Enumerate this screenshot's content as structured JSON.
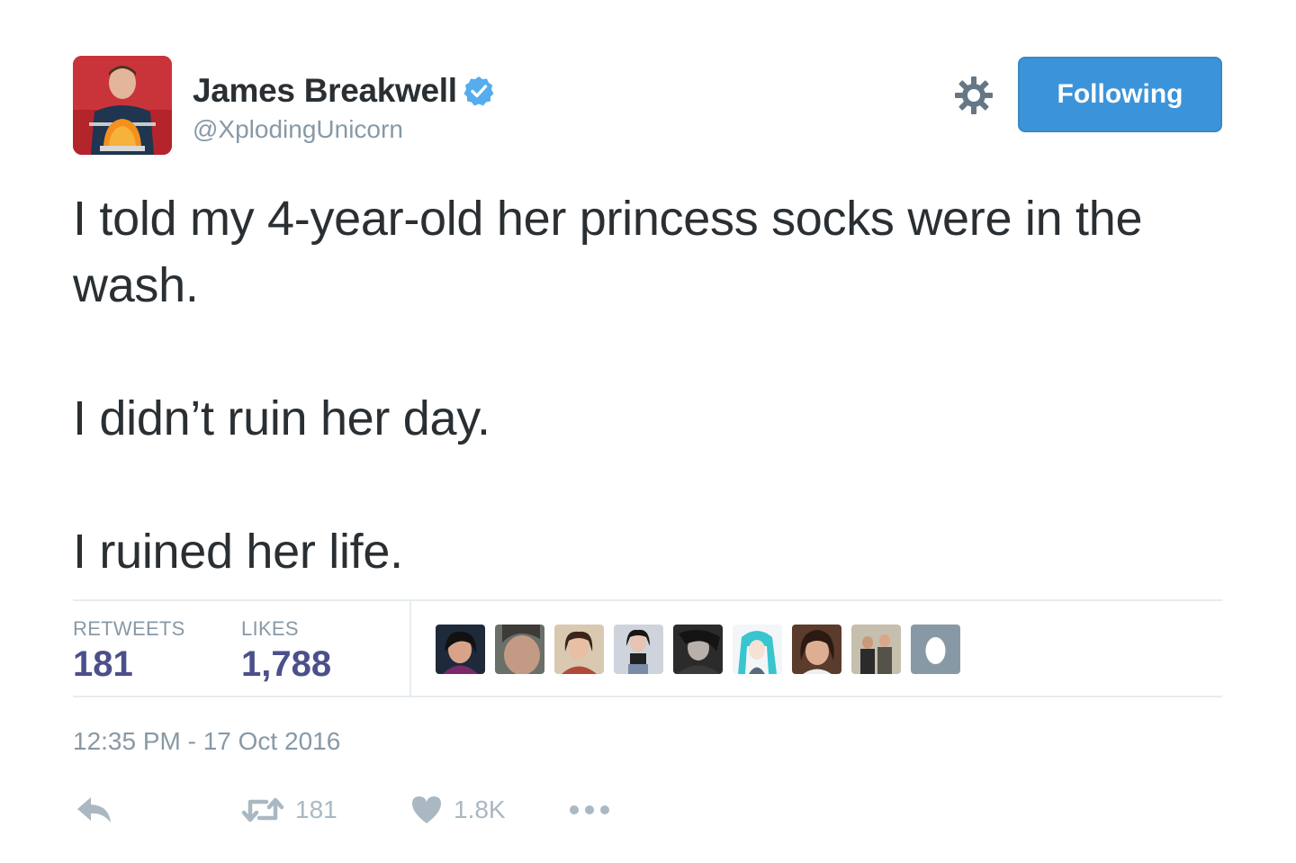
{
  "user": {
    "display_name": "James Breakwell",
    "handle": "@XplodingUnicorn",
    "verified": true
  },
  "follow_button": {
    "label": "Following",
    "color": "#3b94d9"
  },
  "tweet": {
    "paragraphs": [
      "I told my 4-year-old her princess socks were in the wash.",
      "I didn’t ruin her day.",
      "I ruined her life."
    ]
  },
  "stats": {
    "retweets_label": "RETWEETS",
    "retweets_value": "181",
    "likes_label": "LIKES",
    "likes_value": "1,788"
  },
  "timestamp": "12:35 PM - 17 Oct 2016",
  "actions": {
    "reply_icon": "reply-icon",
    "retweet_count": "181",
    "like_count": "1.8K",
    "more_icon": "more-icon"
  },
  "colors": {
    "accent": "#3b94d9",
    "stat_value": "#4b4f8a",
    "muted": "#8899a6",
    "text": "#292f33"
  }
}
